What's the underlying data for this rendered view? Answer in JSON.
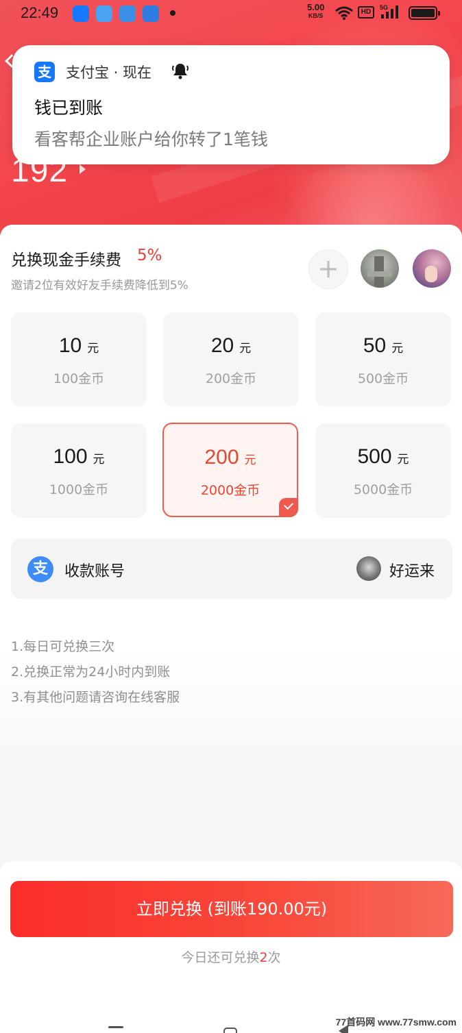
{
  "status_bar": {
    "time": "22:49",
    "net_speed_value": "5.00",
    "net_speed_unit": "KB/S",
    "hd_label": "HD",
    "signal_label": "5G"
  },
  "hero": {
    "coin_balance": "192"
  },
  "notification": {
    "app_icon_glyph": "支",
    "app_name": "支付宝 · 现在",
    "title": "钱已到账",
    "body": "看客帮企业账户给你转了1笔钱"
  },
  "fee": {
    "title": "兑换现金手续费",
    "percent": "5%",
    "subtitle": "邀请2位有效好友手续费降低到5%",
    "invite_symbol": "+"
  },
  "options": [
    {
      "amount": "10",
      "unit": "元",
      "coins": "100金币",
      "selected": false
    },
    {
      "amount": "20",
      "unit": "元",
      "coins": "200金币",
      "selected": false
    },
    {
      "amount": "50",
      "unit": "元",
      "coins": "500金币",
      "selected": false
    },
    {
      "amount": "100",
      "unit": "元",
      "coins": "1000金币",
      "selected": false
    },
    {
      "amount": "200",
      "unit": "元",
      "coins": "2000金币",
      "selected": true
    },
    {
      "amount": "500",
      "unit": "元",
      "coins": "5000金币",
      "selected": false
    }
  ],
  "account": {
    "icon_glyph": "支",
    "label": "收款账号",
    "username": "好运来"
  },
  "rules": [
    "1.每日可兑换三次",
    "2.兑换正常为24小时内到账",
    "3.有其他问题请咨询在线客服"
  ],
  "cta": {
    "label": "立即兑换 (到账190.00元)"
  },
  "remaining": {
    "prefix": "今日还可兑换",
    "count": "2",
    "suffix": "次"
  },
  "watermark": "77首码网 www.77smw.com",
  "colors": {
    "accent": "#ef3d3d",
    "alipay_blue": "#1677ff",
    "selected_border": "#ef5a4f"
  }
}
